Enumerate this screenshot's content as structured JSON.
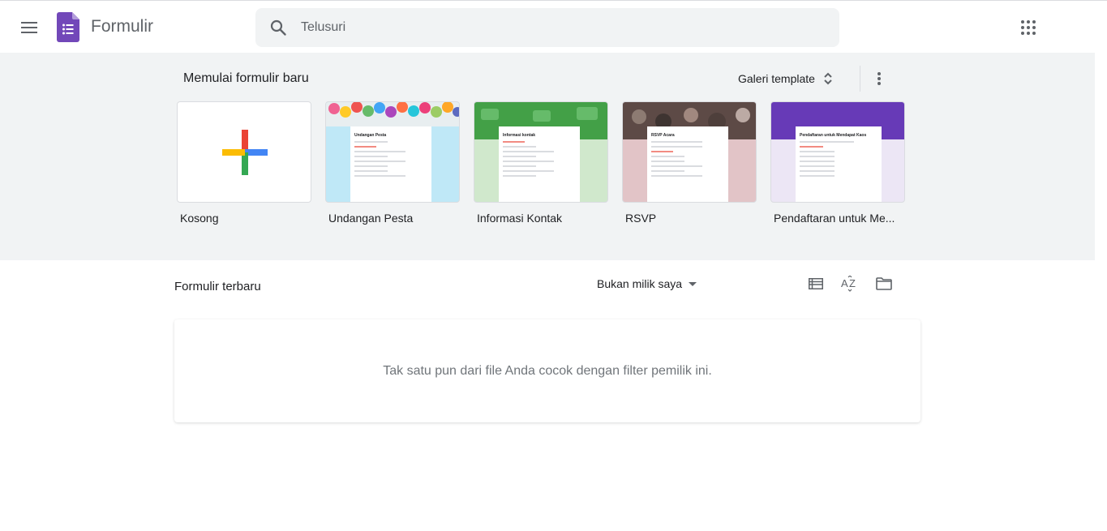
{
  "header": {
    "app_title": "Formulir",
    "search_placeholder": "Telusuri",
    "logo_color": "#7248b9"
  },
  "start": {
    "title": "Memulai formulir baru",
    "gallery_label": "Galeri template",
    "templates": [
      {
        "label": "Kosong"
      },
      {
        "label": "Undangan Pesta",
        "card_title": "Undangan Pesta",
        "bg": "#bfe8f7"
      },
      {
        "label": "Informasi Kontak",
        "card_title": "Informasi kontak",
        "bg": "#d0e8cc"
      },
      {
        "label": "RSVP",
        "card_title": "RSVP Acara",
        "bg": "#e2c4c7"
      },
      {
        "label": "Pendaftaran untuk Me...",
        "card_title": "Pendaftaran untuk Mendapat Kaos",
        "bg": "#ece6f5"
      }
    ]
  },
  "recent": {
    "title": "Formulir terbaru",
    "owner_filter": "Bukan milik saya",
    "empty_message": "Tak satu pun dari file Anda cocok dengan filter pemilik ini."
  }
}
